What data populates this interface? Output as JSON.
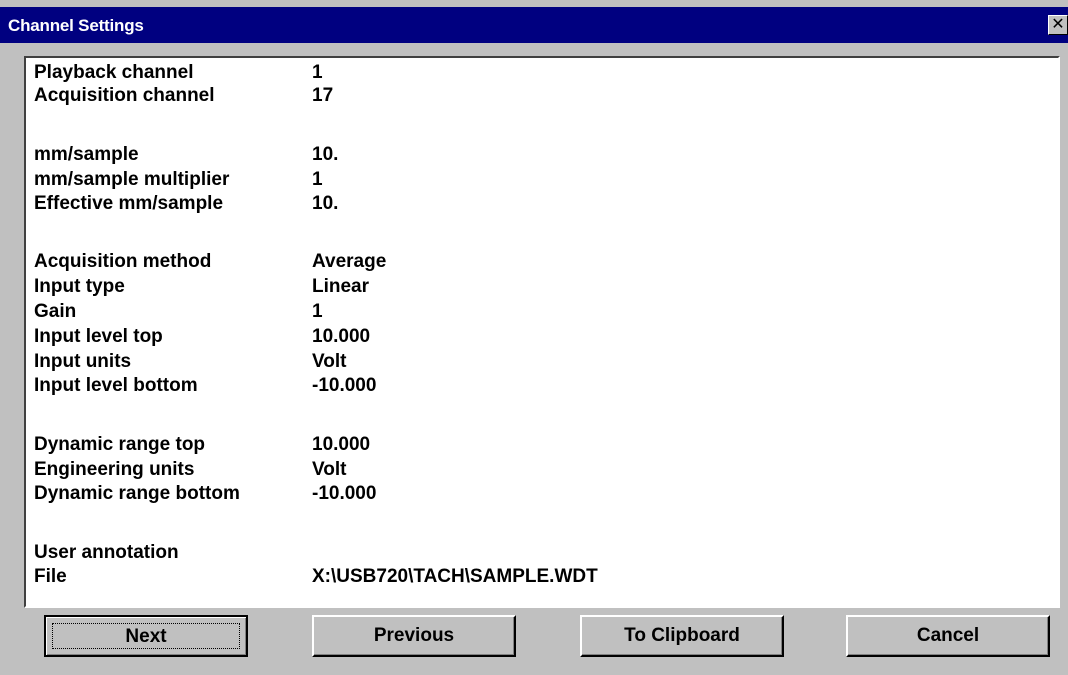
{
  "window": {
    "title": "Channel Settings",
    "close_symbol": "✕"
  },
  "settings": [
    {
      "label": "Playback channel",
      "value": "1"
    },
    {
      "label": "Acquisition channel",
      "value": "17"
    },
    {
      "label": "mm/sample",
      "value": "10."
    },
    {
      "label": "mm/sample multiplier",
      "value": "1"
    },
    {
      "label": "Effective mm/sample",
      "value": "10."
    },
    {
      "label": "Acquisition method",
      "value": "Average"
    },
    {
      "label": "Input type",
      "value": "Linear"
    },
    {
      "label": "Gain",
      "value": "1"
    },
    {
      "label": "Input level top",
      "value": "10.000"
    },
    {
      "label": "Input units",
      "value": "Volt"
    },
    {
      "label": "Input level bottom",
      "value": "-10.000"
    },
    {
      "label": "Dynamic range top",
      "value": "10.000"
    },
    {
      "label": "Engineering units",
      "value": "Volt"
    },
    {
      "label": "Dynamic range bottom",
      "value": "-10.000"
    },
    {
      "label": "User annotation",
      "value": ""
    },
    {
      "label": "File",
      "value": "X:\\USB720\\TACH\\SAMPLE.WDT"
    }
  ],
  "buttons": {
    "next": "Next",
    "previous": "Previous",
    "clipboard": "To Clipboard",
    "cancel": "Cancel"
  },
  "colors": {
    "titlebar": "#000080",
    "dialog_face": "#c0c0c0",
    "panel": "#ffffff"
  }
}
